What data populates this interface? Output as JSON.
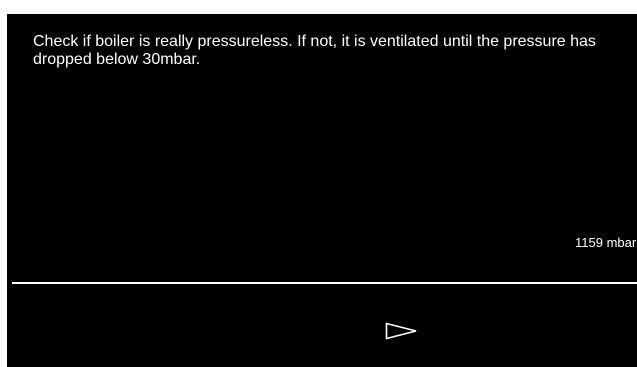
{
  "message": {
    "text": "Check if boiler is really pressureless. If not, it is ventilated until the pressure has dropped below 30mbar."
  },
  "readout": {
    "pressure": "1159 mbar"
  },
  "navigation": {
    "next_icon": "triangle-right-outline-icon"
  },
  "colors": {
    "background": "#000000",
    "foreground": "#ffffff"
  }
}
